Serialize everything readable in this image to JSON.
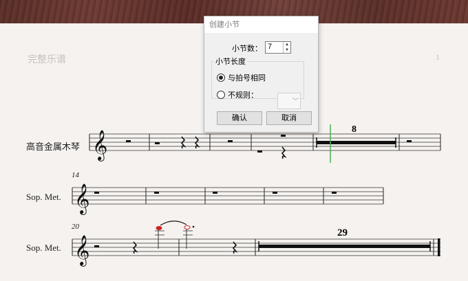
{
  "score": {
    "title": "完整乐谱",
    "page_number": "1",
    "system1": {
      "instrument": "高音金属木琴",
      "multirest_count": "8"
    },
    "system2": {
      "instrument": "Sop. Met.",
      "measure_number": "14"
    },
    "system3": {
      "instrument": "Sop. Met.",
      "measure_number": "20",
      "multirest_count": "29"
    }
  },
  "dialog": {
    "title": "创建小节",
    "count_label": "小节数：",
    "count_value": "7",
    "group_label": "小节长度",
    "option_same": "与拍号相同",
    "option_irregular": "不规则：",
    "selected_option": "option_same",
    "ok_label": "确认",
    "cancel_label": "取消"
  },
  "colors": {
    "cursor": "#4caf50",
    "note_highlight": "#cc2222",
    "wood": "#5b2e28"
  }
}
